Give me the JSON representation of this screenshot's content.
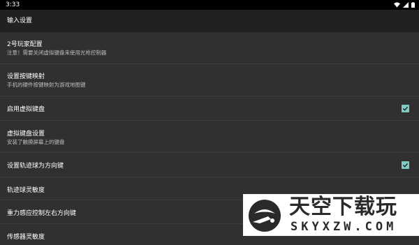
{
  "status_bar": {
    "time": "3:33"
  },
  "app_bar": {
    "title": "输入设置"
  },
  "settings": {
    "player2": {
      "title": "2号玩家配置",
      "summary": "注意！需要关闭虚拟键盘来使用光枪控制器"
    },
    "key_mapping": {
      "title": "设置按键映射",
      "summary": "手机的硬件按键映射为游戏地图键"
    },
    "virtual_keyboard": {
      "title": "启用虚拟键盘",
      "checked": true
    },
    "vk_settings": {
      "title": "虚拟键盘设置",
      "summary": "安装了触摸屏幕上的键盘"
    },
    "trackball_dpad": {
      "title": "设置轨迹球为方向键",
      "checked": true
    },
    "trackball_sensitivity": {
      "title": "轨迹球灵敏度"
    },
    "gravity_lr": {
      "title": "重力感应控制左右方向键"
    },
    "sensor_sensitivity": {
      "title": "传感器灵敏度"
    }
  },
  "watermark": {
    "cn": "天空下载玩",
    "en": "SKYXZW.COM"
  },
  "colors": {
    "accent": "#80cbc4",
    "background": "#303030",
    "app_bar": "#212121"
  }
}
